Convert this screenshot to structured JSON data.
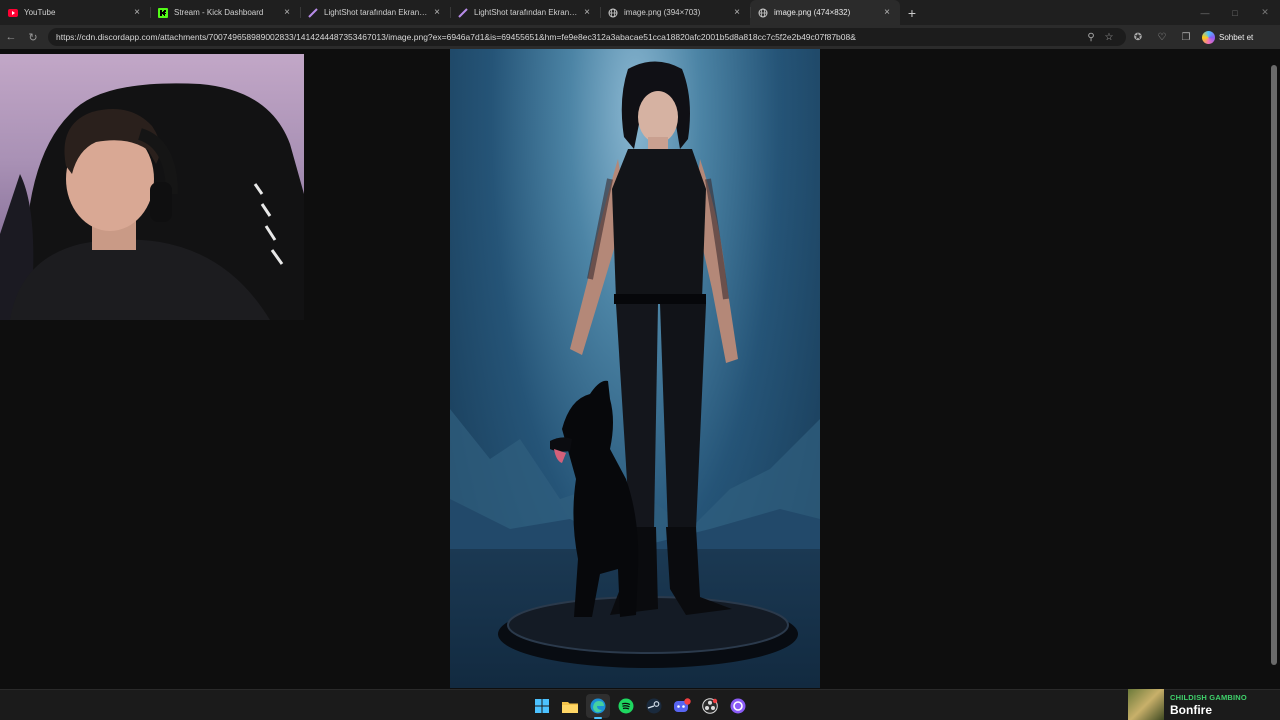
{
  "browser": {
    "tabs": [
      {
        "title": "YouTube",
        "icon": "youtube-icon",
        "active": false
      },
      {
        "title": "Stream - Kick Dashboard",
        "icon": "kick-icon",
        "active": false
      },
      {
        "title": "LightShot tarafından Ekran Görün",
        "icon": "lightshot-icon",
        "active": false
      },
      {
        "title": "LightShot tarafından Ekran Görün",
        "icon": "lightshot-icon",
        "active": false
      },
      {
        "title": "image.png (394×703)",
        "icon": "globe-icon",
        "active": false
      },
      {
        "title": "image.png (474×832)",
        "icon": "globe-icon",
        "active": true
      }
    ],
    "new_tab_label": "+",
    "close_glyph": "×",
    "address": "https://cdn.discordapp.com/attachments/700749658989002833/1414244487353467013/image.png?ex=6946a7d1&is=69455651&hm=fe9e8ec312a3abacae51cca18820afc2001b5d8a818cc7c5f2e2b49c07f87b08&",
    "copilot_label": "Sohbet et"
  },
  "colors": {
    "accent": "#4cc2ff",
    "spotify_green": "#3fd16b",
    "youtube_red": "#ff0033",
    "kick_green": "#53fc18"
  },
  "taskbar": {
    "apps": [
      "windows-start-icon",
      "file-explorer-icon",
      "edge-browser-icon",
      "spotify-icon",
      "steam-icon",
      "discord-icon",
      "obs-icon",
      "twitch-icon"
    ],
    "discord_badge": "99+"
  },
  "now_playing": {
    "artist": "CHILDISH GAMBINO",
    "song": "Bonfire"
  }
}
